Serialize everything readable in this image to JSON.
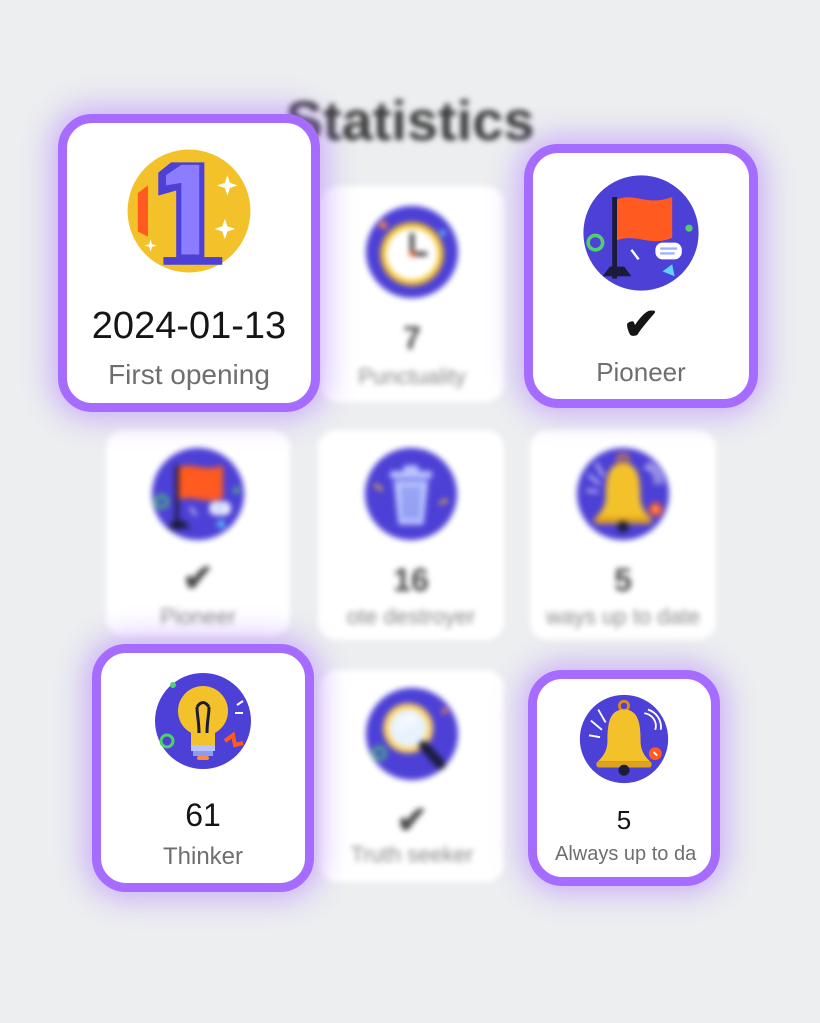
{
  "page": {
    "title": "Statistics"
  },
  "colors": {
    "highlight": "#a66bff",
    "icon_bg": "#4d40d6",
    "check": "#5aa832",
    "gold": "#f3c22b",
    "flag": "#ff5a1f"
  },
  "background_cards": [
    {
      "value": "7",
      "label": "Punctuality",
      "icon": "clock-icon"
    },
    {
      "value": "✔",
      "label": "Pioneer",
      "icon": "flag-icon"
    },
    {
      "value": "16",
      "label": "ote destroyer",
      "icon": "trash-icon"
    },
    {
      "value": "5",
      "label": "ways up to date",
      "icon": "bell-icon"
    },
    {
      "value": "✔",
      "label": "Truth seeker",
      "icon": "magnifier-icon"
    }
  ],
  "highlight_cards": [
    {
      "value": "2024-01-13",
      "label": "First opening",
      "icon": "number-one-icon"
    },
    {
      "value": "✔",
      "label": "Pioneer",
      "icon": "flag-icon"
    },
    {
      "value": "61",
      "label": "Thinker",
      "icon": "lightbulb-icon"
    },
    {
      "value": "5",
      "label": "Always up to da",
      "icon": "bell-icon"
    }
  ]
}
